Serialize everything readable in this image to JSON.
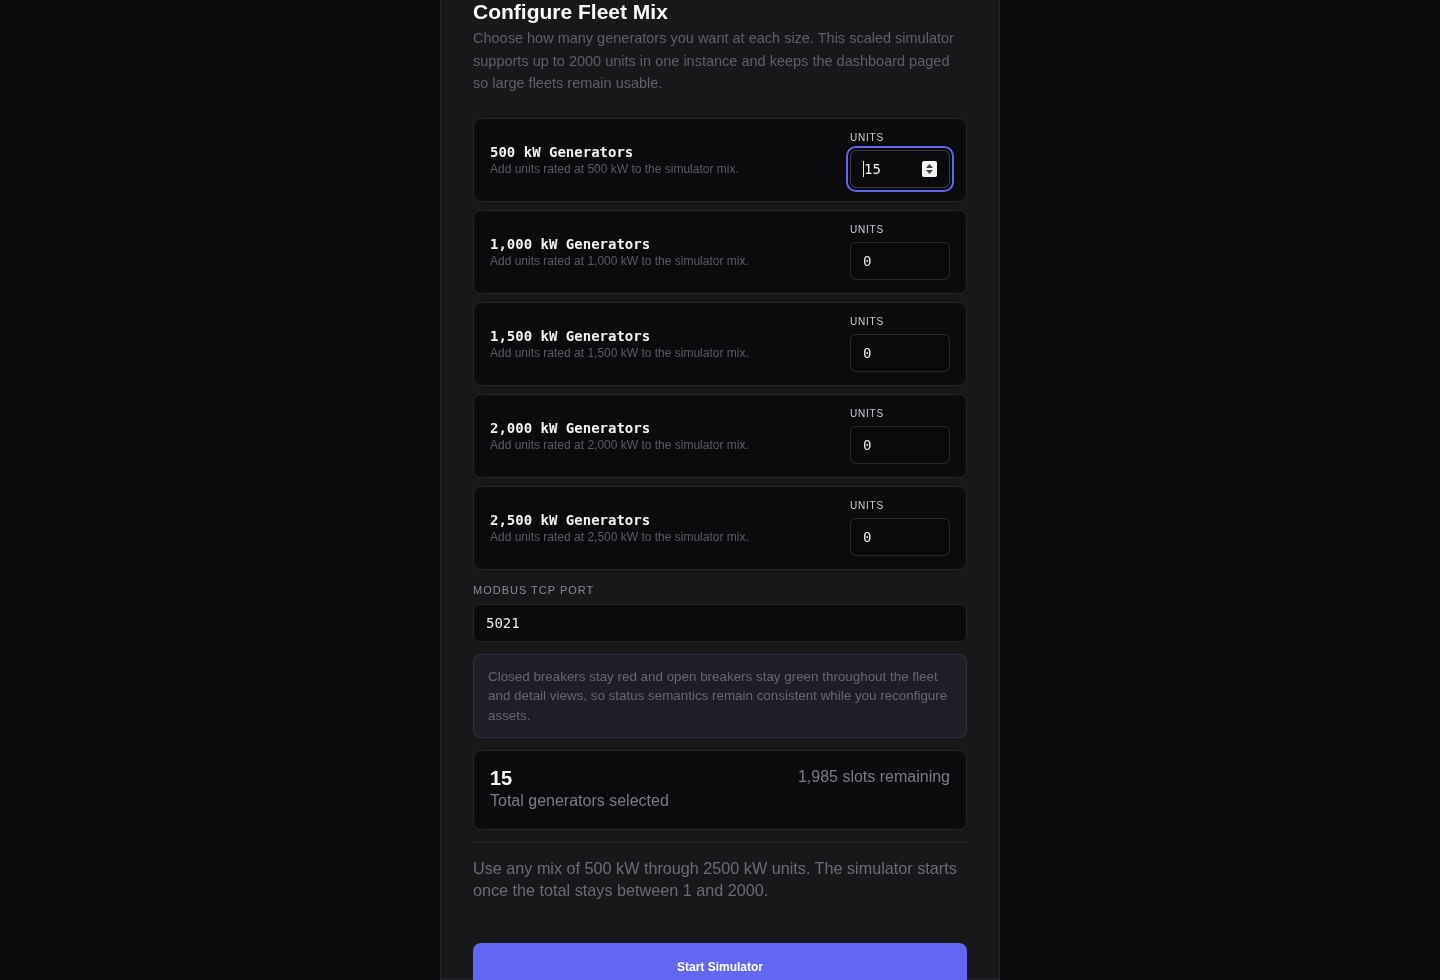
{
  "panel": {
    "title": "Configure Fleet Mix",
    "description": "Choose how many generators you want at each size. This scaled simulator supports up to 2000 units in one instance and keeps the dashboard paged so large fleets remain usable.",
    "generator_types": [
      {
        "name": "500 kW Generators",
        "description": "Add units rated at 500 kW to the simulator mix.",
        "field_label": "UNITS",
        "value": "15",
        "focused": true
      },
      {
        "name": "1,000 kW Generators",
        "description": "Add units rated at 1,000 kW to the simulator mix.",
        "field_label": "UNITS",
        "value": "0",
        "focused": false
      },
      {
        "name": "1,500 kW Generators",
        "description": "Add units rated at 1,500 kW to the simulator mix.",
        "field_label": "UNITS",
        "value": "0",
        "focused": false
      },
      {
        "name": "2,000 kW Generators",
        "description": "Add units rated at 2,000 kW to the simulator mix.",
        "field_label": "UNITS",
        "value": "0",
        "focused": false
      },
      {
        "name": "2,500 kW Generators",
        "description": "Add units rated at 2,500 kW to the simulator mix.",
        "field_label": "UNITS",
        "value": "0",
        "focused": false
      }
    ],
    "port": {
      "label": "MODBUS TCP PORT",
      "value": "5021"
    },
    "note": "Closed breakers stay red and open breakers stay green throughout the fleet and detail views, so status semantics remain consistent while you reconfigure assets.",
    "summary": {
      "total": "15",
      "total_label": "Total generators selected",
      "remaining": "1,985 slots remaining"
    },
    "footnote": "Use any mix of 500 kW through 2500 kW units. The simulator starts once the total stays between 1 and 2000.",
    "start_button": "Start Simulator"
  }
}
